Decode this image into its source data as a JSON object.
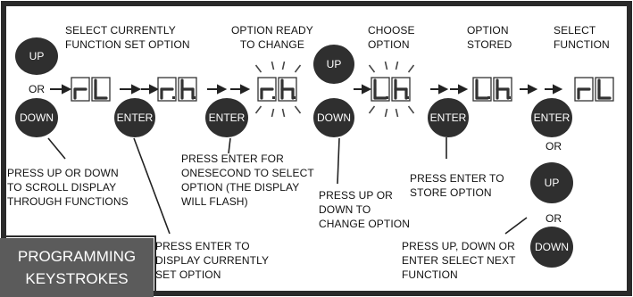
{
  "labels": {
    "select_current": "SELECT CURRENTLY\nFUNCTION SET OPTION",
    "option_ready": "OPTION READY\nTO CHANGE",
    "choose_option": "CHOOSE\nOPTION",
    "option_stored": "OPTION\nSTORED",
    "select_function": "SELECT\nFUNCTION",
    "or_left": "OR",
    "press_up_down_scroll": "PRESS UP OR DOWN\nTO SCROLL DISPLAY\nTHROUGH FUNCTIONS",
    "press_enter_display": "PRESS ENTER TO\nDISPLAY CURRENTLY\nSET OPTION",
    "press_enter_one_second": "PRESS ENTER FOR\nONESECOND TO SELECT\nOPTION (THE DISPLAY\nWILL FLASH)",
    "press_up_down_change": "PRESS UP OR\nDOWN TO\nCHANGE OPTION",
    "press_enter_store": "PRESS ENTER TO\nSTORE OPTION",
    "or_right_1": "OR",
    "or_right_2": "OR",
    "press_up_down_enter_next": "PRESS UP, DOWN OR\nENTER SELECT NEXT\nFUNCTION"
  },
  "buttons": {
    "up_1": "UP",
    "down_1": "DOWN",
    "enter_1": "ENTER",
    "enter_2": "ENTER",
    "up_2": "UP",
    "down_2": "DOWN",
    "enter_3": "ENTER",
    "enter_4": "ENTER",
    "up_3": "UP",
    "down_3": "DOWN"
  },
  "displays": [
    {
      "chars": "rL",
      "flashing": false
    },
    {
      "chars": "r.h.",
      "flashing": false
    },
    {
      "chars": "r.h.",
      "flashing": true
    },
    {
      "chars": "L.h.",
      "flashing": true
    },
    {
      "chars": "L.h.",
      "flashing": false
    },
    {
      "chars": "rL",
      "flashing": false
    }
  ],
  "corner_label": {
    "line1": "PROGRAMMING",
    "line2": "KEYSTROKES"
  },
  "colors": {
    "frame": "#2a2a2a",
    "button": "#2f2f2f",
    "corner_bg": "#5b5b5b",
    "display_stroke": "#333333"
  }
}
